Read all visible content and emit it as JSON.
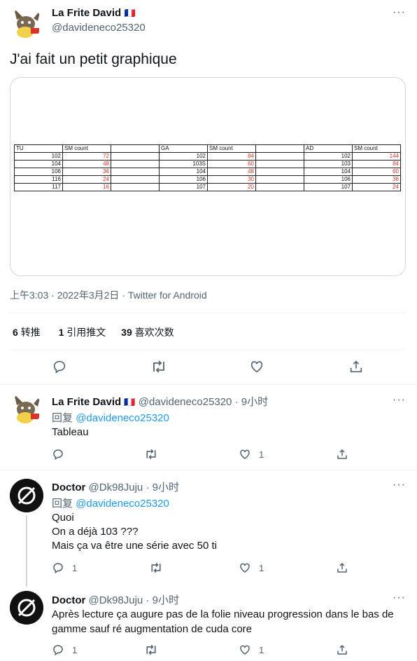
{
  "main_tweet": {
    "author_name": "La Frite David",
    "author_flag": "🇫🇷",
    "author_handle": "@davideneco25320",
    "text": "J'ai fait un petit graphique",
    "timestamp": "上午3:03 · 2022年3月2日 · Twitter for Android",
    "stats": {
      "retweets_count": "6",
      "retweets_label": "转推",
      "quotes_count": "1",
      "quotes_label": "引用推文",
      "likes_count": "39",
      "likes_label": "喜欢次数"
    }
  },
  "sheet": {
    "groups": [
      {
        "header": "TU",
        "count_header": "SM count",
        "rows": [
          [
            "102",
            "72"
          ],
          [
            "104",
            "48"
          ],
          [
            "106",
            "36"
          ],
          [
            "116",
            "24"
          ],
          [
            "117",
            "16"
          ]
        ]
      },
      {
        "header": "GA",
        "count_header": "SM count",
        "rows": [
          [
            "102",
            "84"
          ],
          [
            "103S",
            "60"
          ],
          [
            "104",
            "48"
          ],
          [
            "106",
            "30"
          ],
          [
            "107",
            "20"
          ]
        ]
      },
      {
        "header": "AD",
        "count_header": "SM count",
        "rows": [
          [
            "102",
            "144"
          ],
          [
            "103",
            "84"
          ],
          [
            "104",
            "60"
          ],
          [
            "106",
            "36"
          ],
          [
            "107",
            "24"
          ]
        ]
      }
    ]
  },
  "replies": [
    {
      "author_name": "La Frite David",
      "author_flag": "🇫🇷",
      "meta": "@davideneco25320 · 9小时",
      "reply_prefix": "回复",
      "reply_to": "@davideneco25320",
      "lines": [
        "Tableau"
      ],
      "reply_count": "",
      "like_count": "1"
    },
    {
      "author_name": "Doctor",
      "meta": "@Dk98Juju · 9小时",
      "reply_prefix": "回复",
      "reply_to": "@davideneco25320",
      "lines": [
        "Quoi",
        "On a déjà 103 ???",
        "Mais ça va être une série avec 50 ti"
      ],
      "reply_count": "1",
      "like_count": "1"
    },
    {
      "author_name": "Doctor",
      "meta": "@Dk98Juju · 9小时",
      "lines": [
        "Après lecture ça augure pas de la folie niveau progression dans le bas de",
        "gamme sauf ré augmentation de cuda core"
      ],
      "reply_count": "1",
      "like_count": "1"
    }
  ]
}
